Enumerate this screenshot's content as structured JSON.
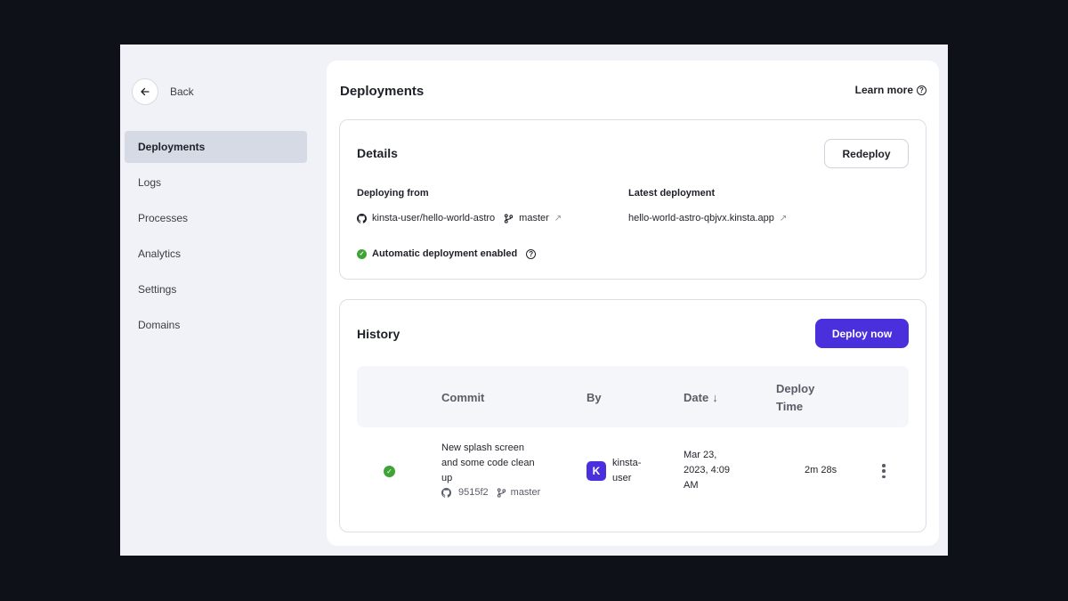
{
  "sidebar": {
    "back_label": "Back",
    "items": [
      {
        "label": "Deployments",
        "active": true
      },
      {
        "label": "Logs"
      },
      {
        "label": "Processes"
      },
      {
        "label": "Analytics"
      },
      {
        "label": "Settings"
      },
      {
        "label": "Domains"
      }
    ]
  },
  "header": {
    "title": "Deployments",
    "learn_more": "Learn more"
  },
  "details": {
    "title": "Details",
    "redeploy_label": "Redeploy",
    "deploying_from_label": "Deploying from",
    "repo": "kinsta-user/hello-world-astro",
    "branch": "master",
    "latest_label": "Latest deployment",
    "latest_url": "hello-world-astro-qbjvx.kinsta.app",
    "auto_deploy": "Automatic deployment enabled"
  },
  "history": {
    "title": "History",
    "deploy_now_label": "Deploy now",
    "columns": {
      "commit": "Commit",
      "by": "By",
      "date": "Date",
      "deploy_time_1": "Deploy",
      "deploy_time_2": "Time"
    },
    "rows": [
      {
        "status": "success",
        "commit_line1": "New splash screen",
        "commit_line2": "and some code clean",
        "commit_line3": "up",
        "hash": "9515f2",
        "branch": "master",
        "avatar_letter": "K",
        "by_line1": "kinsta-",
        "by_line2": "user",
        "date_line1": "Mar 23,",
        "date_line2": "2023, 4:09",
        "date_line3": "AM",
        "deploy_time": "2m 28s"
      }
    ]
  },
  "colors": {
    "accent": "#4a2fdc",
    "success": "#3fa436",
    "active_nav": "#d5dae5"
  }
}
